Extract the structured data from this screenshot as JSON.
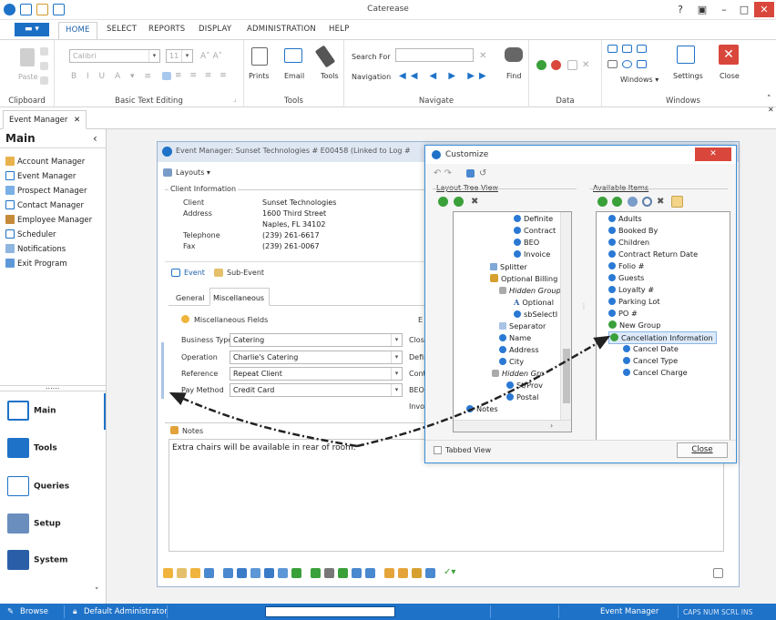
{
  "window": {
    "title": "Caterease",
    "help": "?",
    "min": "–",
    "max": "□",
    "close": "✕"
  },
  "menu": {
    "file_label": "▬ ▾",
    "tabs": [
      "HOME",
      "SELECT",
      "REPORTS",
      "DISPLAY",
      "ADMINISTRATION",
      "HELP"
    ]
  },
  "ribbon": {
    "clipboard": {
      "label": "Clipboard",
      "paste": "Paste"
    },
    "basic_text": {
      "label": "Basic Text Editing",
      "font": "Calibri",
      "size": "11"
    },
    "tools": {
      "label": "Tools",
      "prints": "Prints",
      "email": "Email",
      "tools": "Tools"
    },
    "navigate": {
      "label": "Navigate",
      "search_for": "Search For",
      "navigation": "Navigation",
      "find": "Find"
    },
    "data": {
      "label": "Data"
    },
    "windows": {
      "label": "Windows",
      "windows_dd": "Windows ▾",
      "settings": "Settings",
      "close": "Close"
    }
  },
  "doc_tab": {
    "label": "Event Manager",
    "close": "✕"
  },
  "sidebar": {
    "title": "Main",
    "items": [
      "Account Manager",
      "Event Manager",
      "Prospect Manager",
      "Contact Manager",
      "Employee Manager",
      "Scheduler",
      "Notifications",
      "Exit Program"
    ],
    "big": [
      "Main",
      "Tools",
      "Queries",
      "Setup",
      "System"
    ],
    "dots": "......"
  },
  "event_manager": {
    "title": "Event Manager:  Sunset Technologies # E00458  (Linked to Log #",
    "layouts": "Layouts ▾",
    "client_info": "Client Information",
    "client_rows": [
      {
        "label": "Client",
        "value": "Sunset Technologies"
      },
      {
        "label": "Address",
        "value": "1600 Third Street"
      },
      {
        "label": "",
        "value": "Naples, FL 34102"
      },
      {
        "label": "Telephone",
        "value": "(239) 261-6617"
      },
      {
        "label": "Fax",
        "value": "(239) 261-0067"
      }
    ],
    "tab_event": "Event",
    "tab_subevent": "Sub-Event",
    "subtabs": [
      "General",
      "Miscellaneous"
    ],
    "misc_header": "Miscellaneous Fields",
    "fields": [
      {
        "label": "Business Type",
        "value": "Catering"
      },
      {
        "label": "Operation",
        "value": "Charlie's Catering"
      },
      {
        "label": "Reference",
        "value": "Repeat Client"
      },
      {
        "label": "Pay Method",
        "value": "Credit Card"
      }
    ],
    "right_labels": [
      "E",
      "Close",
      "Defin",
      "Cont",
      "BEO",
      "Invoi"
    ],
    "notes_label": "Notes",
    "notes_text": "Extra chairs will be available in rear of room."
  },
  "customize": {
    "title": "Customize",
    "close": "✕",
    "layout_tree_label": "Layout Tree View",
    "available_label": "Available Items",
    "layout_nodes": [
      {
        "text": "Definite",
        "kind": "b"
      },
      {
        "text": "Contract",
        "kind": "b"
      },
      {
        "text": "BEO",
        "kind": "b"
      },
      {
        "text": "Invoice",
        "kind": "b"
      },
      {
        "text": "Splitter",
        "kind": "s"
      },
      {
        "text": "Optional Billing",
        "kind": "g"
      },
      {
        "text": "Hidden Group",
        "kind": "h"
      },
      {
        "text": "Optional",
        "kind": "a"
      },
      {
        "text": "sbSelectI",
        "kind": "b"
      },
      {
        "text": "Separator",
        "kind": "s"
      },
      {
        "text": "Name",
        "kind": "b"
      },
      {
        "text": "Address",
        "kind": "b"
      },
      {
        "text": "City",
        "kind": "b"
      },
      {
        "text": "Hidden Gro",
        "kind": "h"
      },
      {
        "text": "St/Prov",
        "kind": "b"
      },
      {
        "text": "Postal",
        "kind": "b"
      },
      {
        "text": "Notes",
        "kind": "b"
      }
    ],
    "available_nodes": [
      "Adults",
      "Booked By",
      "Children",
      "Contract Return Date",
      "Folio #",
      "Guests",
      "Loyalty #",
      "Parking Lot",
      "PO #",
      "New Group",
      "Cancellation Information",
      "Cancel Date",
      "Cancel Type",
      "Cancel Charge"
    ],
    "tabbed_view": "Tabbed View",
    "close_button": "Close"
  },
  "status": {
    "mode": "Browse",
    "user": "Default Administrator",
    "module": "Event Manager",
    "keys": "CAPS  NUM  SCRL  INS"
  },
  "colors": {
    "accent": "#1e72c8",
    "close_red": "#d9473c",
    "green": "#3aa03a",
    "node_blue": "#2a79d4"
  }
}
